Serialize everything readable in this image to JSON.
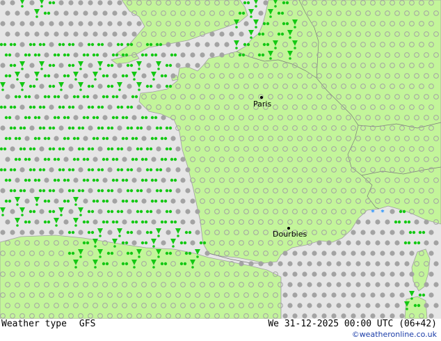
{
  "map": {
    "colors": {
      "sea": "#e6e6e6",
      "land": "#c3f59a",
      "coast": "#a0a0a0",
      "border": "#7a7a7a",
      "dry_symbol": "#a3a3a3",
      "rain_symbol": "#14c814",
      "snow_symbol": "#1e90ff"
    },
    "cities": [
      {
        "name": "Paris"
      },
      {
        "name": "Dourbies"
      }
    ]
  },
  "footer": {
    "label": "Weather type",
    "model": "GFS",
    "valid_time": "We 31-12-2025 00:00 UTC (06+42)",
    "credit": "©weatheronline.co.uk"
  }
}
